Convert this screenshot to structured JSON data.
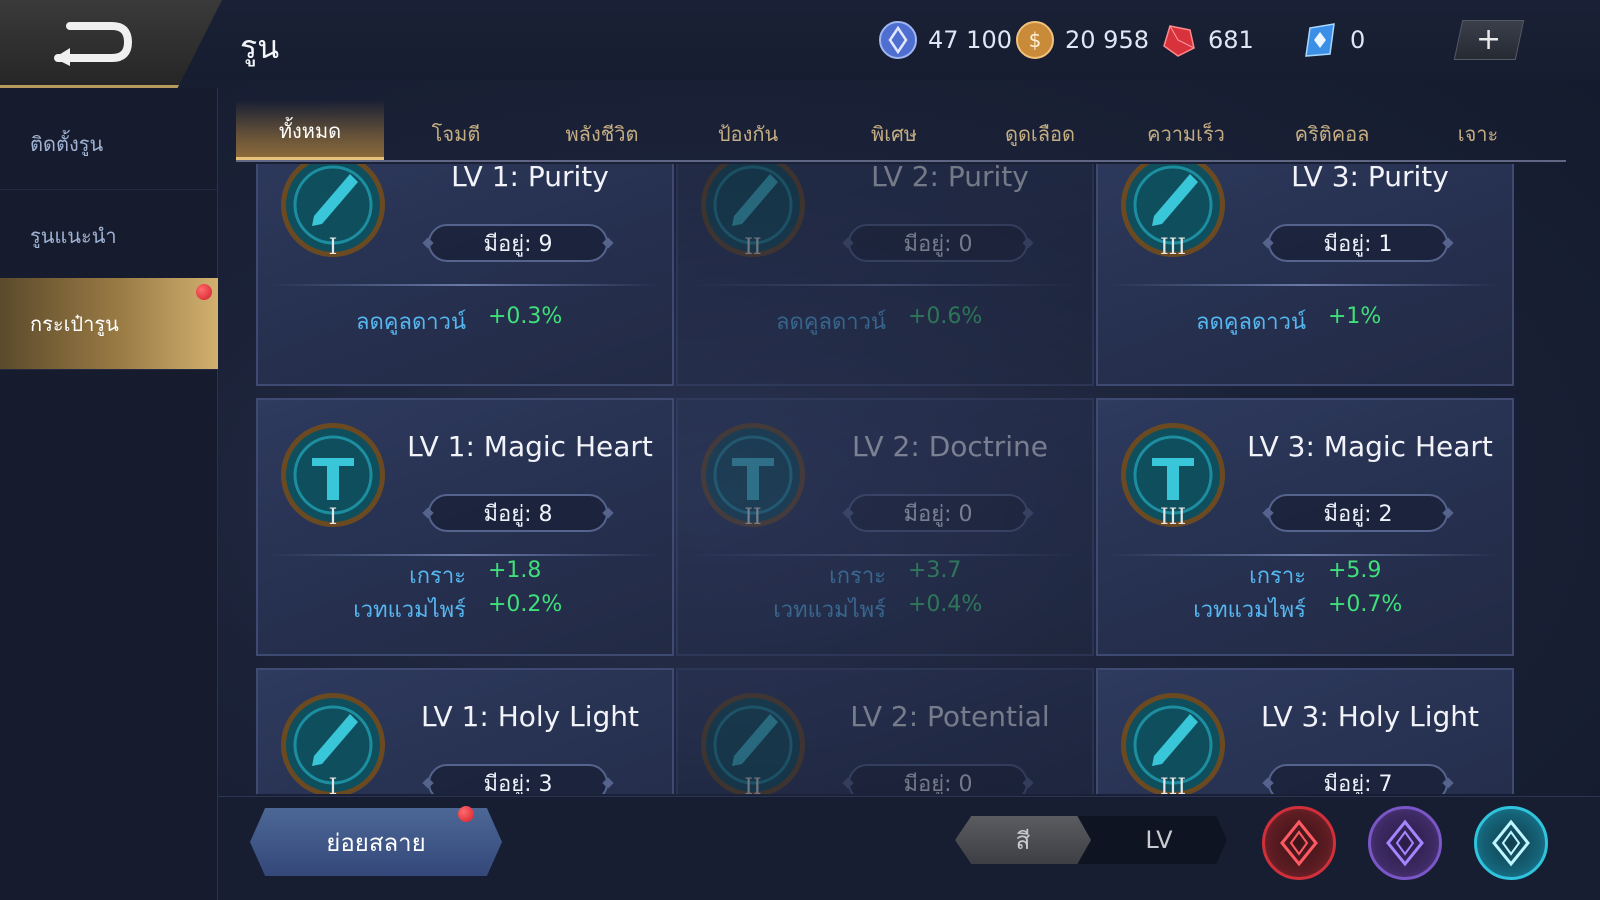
{
  "header": {
    "title": "รูน",
    "currencies": [
      {
        "name": "blue-coin",
        "value": "47 100"
      },
      {
        "name": "gold-coin",
        "value": "20 958"
      },
      {
        "name": "ruby",
        "value": "681"
      },
      {
        "name": "diamond",
        "value": "0"
      }
    ],
    "plus": "+"
  },
  "sidebar": {
    "items": [
      {
        "label": "ติดตั้งรูน"
      },
      {
        "label": "รูนแนะนำ"
      },
      {
        "label": "กระเป๋ารูน"
      }
    ]
  },
  "tabs": [
    "ทั้งหมด",
    "โจมตี",
    "พลังชีวิต",
    "ป้องกัน",
    "พิเศษ",
    "ดูดเลือด",
    "ความเร็ว",
    "คริติคอล",
    "เจาะ"
  ],
  "cards": [
    {
      "name": "LV 1: Purity",
      "numeral": "I",
      "owned": "มีอยู่: 9",
      "stats": [
        {
          "label": "ลดคูลดาวน์",
          "value": "+0.3%"
        }
      ]
    },
    {
      "name": "LV 2: Purity",
      "numeral": "II",
      "owned": "มีอยู่: 0",
      "stats": [
        {
          "label": "ลดคูลดาวน์",
          "value": "+0.6%"
        }
      ]
    },
    {
      "name": "LV 3: Purity",
      "numeral": "III",
      "owned": "มีอยู่: 1",
      "stats": [
        {
          "label": "ลดคูลดาวน์",
          "value": "+1%"
        }
      ]
    },
    {
      "name": "LV 1: Magic Heart",
      "numeral": "I",
      "owned": "มีอยู่: 8",
      "stats": [
        {
          "label": "เกราะ",
          "value": "+1.8"
        },
        {
          "label": "เวทแวมไพร์",
          "value": "+0.2%"
        }
      ]
    },
    {
      "name": "LV 2: Doctrine",
      "numeral": "II",
      "owned": "มีอยู่: 0",
      "stats": [
        {
          "label": "เกราะ",
          "value": "+3.7"
        },
        {
          "label": "เวทแวมไพร์",
          "value": "+0.4%"
        }
      ]
    },
    {
      "name": "LV 3: Magic Heart",
      "numeral": "III",
      "owned": "มีอยู่: 2",
      "stats": [
        {
          "label": "เกราะ",
          "value": "+5.9"
        },
        {
          "label": "เวทแวมไพร์",
          "value": "+0.7%"
        }
      ]
    },
    {
      "name": "LV 1: Holy Light",
      "numeral": "I",
      "owned": "มีอยู่: 3",
      "stats": []
    },
    {
      "name": "LV 2: Potential",
      "numeral": "II",
      "owned": "มีอยู่: 0",
      "stats": []
    },
    {
      "name": "LV 3: Holy Light",
      "numeral": "III",
      "owned": "มีอยู่: 7",
      "stats": []
    }
  ],
  "bottom": {
    "disassemble_label": "ย่อยสลาย",
    "sort_options": [
      "สี",
      "LV"
    ],
    "filters": [
      {
        "name": "red-rune-filter",
        "color": "#d1303a"
      },
      {
        "name": "purple-rune-filter",
        "color": "#7a56c7"
      },
      {
        "name": "blue-rune-filter",
        "color": "#2fc4de"
      }
    ]
  },
  "colors": {
    "stat_label": "#56b7f0",
    "stat_value": "#3fe07a",
    "accent_gold": "#e6c27a"
  }
}
